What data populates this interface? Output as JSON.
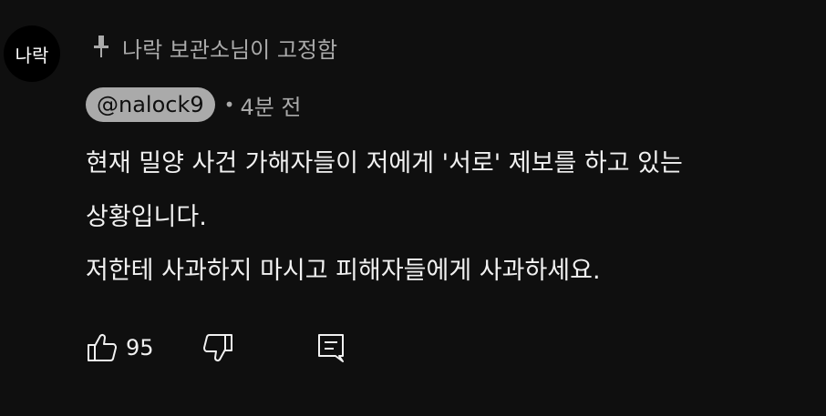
{
  "avatar": {
    "text": "나락"
  },
  "pinned": {
    "label": "나락 보관소님이 고정함",
    "icon": "pin-icon"
  },
  "comment": {
    "author": "@nalock9",
    "separator": "•",
    "time": "4분 전",
    "lines": [
      "현재 밀양 사건 가해자들이 저에게 '서로' 제보를 하고 있는",
      "상황입니다.",
      "저한테 사과하지 마시고 피해자들에게 사과하세요."
    ]
  },
  "actions": {
    "like_icon": "thumbs-up-icon",
    "like_count": "95",
    "dislike_icon": "thumbs-down-icon",
    "reply_icon": "reply-icon"
  },
  "colors": {
    "background": "#0f0f0f",
    "text": "#f1f1f1",
    "secondary_text": "#aaaaaa",
    "author_chip": "#aaaaaa"
  }
}
